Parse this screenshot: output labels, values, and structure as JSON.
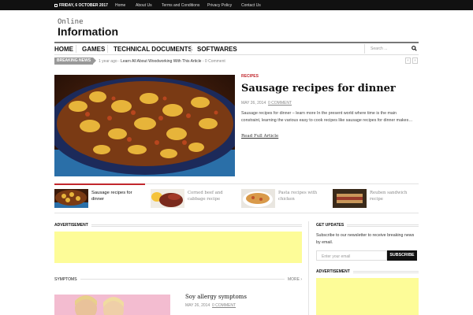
{
  "topbar": {
    "date": "FRIDAY, 6 OCTOBER 2017",
    "links": [
      "Home",
      "About Us",
      "Terms and Conditions",
      "Privacy Policy",
      "Contact Us"
    ]
  },
  "logo": {
    "line1": "Online",
    "line2": "Information"
  },
  "nav": {
    "items": [
      "HOME",
      "GAMES",
      "TECHNICAL DOCUMENTS",
      "SOFTWARES"
    ],
    "search_placeholder": "Search ...",
    "search_icon": "search-icon"
  },
  "breaking": {
    "label": "BREAKING NEWS",
    "time": "1 year ago",
    "sep": " - ",
    "headline": "Learn All About Woodworking With This Article",
    "comments": " - 0 Comment",
    "prev": "‹",
    "next": "›"
  },
  "featured": {
    "category": "RECIPES",
    "title": "Sausage recipes for dinner",
    "date": "MAY 26, 2014",
    "comments": "0 COMMENT",
    "excerpt": "Sausage recipes for dinner – learn more In the present world where time is the main constraint, learning the various easy to cook recipes like sausage recipes for dinner makes…",
    "read_more": "Read Full Article"
  },
  "thumbs": [
    {
      "title": "Sausage recipes for dinner"
    },
    {
      "title": "Corned beef and cabbage recipe"
    },
    {
      "title": "Pasta recipes with chicken"
    },
    {
      "title": "Reuben sandwich recipe"
    }
  ],
  "advertisement": {
    "label": "ADVERTISEMENT"
  },
  "updates": {
    "label": "GET UPDATES",
    "text": "Subscribe to our newsletter to receive breaking news by email.",
    "email_placeholder": "Enter your email",
    "button": "SUBSCRIBE"
  },
  "sidebar_ad": {
    "label": "ADVERTISEMENT"
  },
  "symptoms": {
    "label": "SYMPTOMS",
    "more": "MORE",
    "post_title": "Soy allergy symptoms",
    "post_date": "MAY 26, 2014",
    "post_comments": "0 COMMENT"
  },
  "colors": {
    "accent": "#c1272d",
    "ad_yellow": "#fdfc98",
    "topbar": "#111111"
  }
}
